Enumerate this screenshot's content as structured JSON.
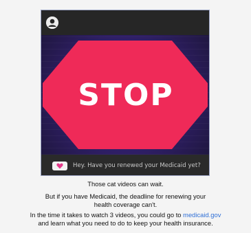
{
  "card": {
    "stop_text": "STOP",
    "message": "Hey. Have you renewed your Medicaid yet?",
    "colors": {
      "stop_sign": "#ef2a58",
      "background": "#3a2480",
      "accent_heart": "#e33a8a"
    },
    "icons": {
      "avatar": "user-avatar-icon",
      "message": "message-heart-icon"
    }
  },
  "body": {
    "line1": "Those cat videos can wait.",
    "line2a": "But if you have Medicaid, the deadline for renewing your",
    "line2b": "health coverage can't.",
    "line3a_prefix": "In the time it takes to watch 3 videos, you could go to",
    "link": "medicaid.gov",
    "line3b": "and learn what you need to do to keep your health insurance."
  }
}
